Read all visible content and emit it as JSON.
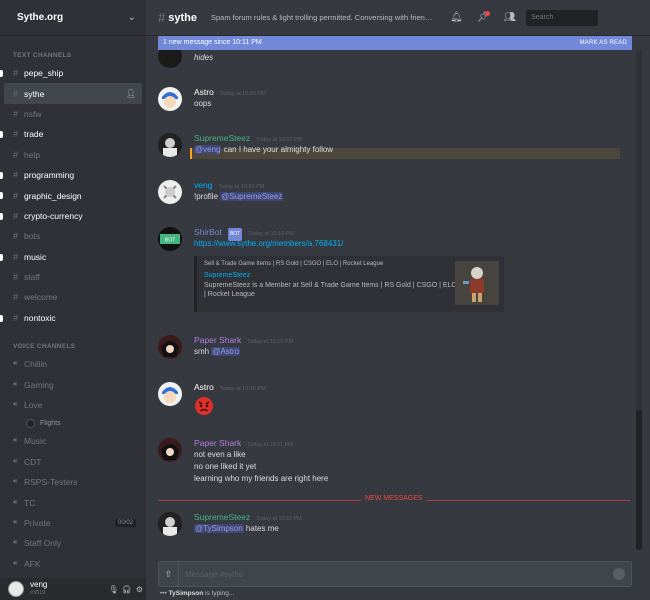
{
  "guild": {
    "name": "Sythe.org"
  },
  "sidebar": {
    "text_category": "TEXT CHANNELS",
    "text_channels": [
      {
        "name": "pepe_ship",
        "state": "unread"
      },
      {
        "name": "sythe",
        "state": "active"
      },
      {
        "name": "nsfw",
        "state": "muted"
      },
      {
        "name": "trade",
        "state": "unread"
      },
      {
        "name": "help",
        "state": "muted"
      },
      {
        "name": "programming",
        "state": "unread"
      },
      {
        "name": "graphic_design",
        "state": "unread"
      },
      {
        "name": "crypto-currency",
        "state": "unread"
      },
      {
        "name": "bots",
        "state": "muted"
      },
      {
        "name": "music",
        "state": "unread"
      },
      {
        "name": "staff",
        "state": "muted"
      },
      {
        "name": "welcome",
        "state": "muted"
      },
      {
        "name": "nontoxic",
        "state": "unread"
      }
    ],
    "voice_category": "VOICE CHANNELS",
    "voice_channels": [
      {
        "name": "Chillin",
        "badge": ""
      },
      {
        "name": "Gaming",
        "badge": ""
      },
      {
        "name": "Love",
        "badge": "",
        "users": [
          "Flights"
        ]
      },
      {
        "name": "Music",
        "badge": ""
      },
      {
        "name": "CDT",
        "badge": ""
      },
      {
        "name": "RSPS-Testers",
        "badge": ""
      },
      {
        "name": "TC",
        "badge": ""
      },
      {
        "name": "Private",
        "badge": "00/02"
      },
      {
        "name": "Staff Only",
        "badge": ""
      },
      {
        "name": "AFK",
        "badge": ""
      }
    ]
  },
  "user": {
    "name": "veng",
    "tag": "#3519"
  },
  "channel": {
    "name": "sythe",
    "topic": "Spam forum rules & light trolling permitted. Conversing with friends does n...",
    "search_placeholder": "Search"
  },
  "new_banner": {
    "text": "1 new message since 10:11 PM",
    "action": "MARK AS READ"
  },
  "messages": [
    {
      "id": "hides",
      "lines": [
        "hides"
      ]
    },
    {
      "id": "astro1",
      "author": "Astro",
      "color": "#ffffff",
      "time": "Today at 10:09 PM",
      "lines": [
        "oops"
      ]
    },
    {
      "id": "steez1",
      "author": "SupremeSteez",
      "color": "#43b581",
      "time": "Today at 10:10 PM",
      "mention": "@veng",
      "text": " can I have your almighty follow"
    },
    {
      "id": "veng1",
      "author": "veng",
      "color": "#00b0f4",
      "time": "Today at 10:10 PM",
      "prefix": "!profile ",
      "mention": "@SupremeSteez"
    },
    {
      "id": "bot1",
      "author": "ShirBot",
      "color": "#7289da",
      "bot": "BOT",
      "time": "Today at 10:10 PM",
      "link": "https://www.sythe.org/members/a.768431/",
      "embed": {
        "provider": "Sell & Trade Game Items | RS Gold | CSGO | ELO | Rocket League",
        "title": "SupremeSteez",
        "description": "SupremeSteez is a Member at Sell & Trade Game Items | RS Gold | CSGO | ELO | Rocket League"
      }
    },
    {
      "id": "shark1",
      "author": "Paper Shark",
      "color": "#b47ee0",
      "time": "Today at 10:10 PM",
      "prefix": "smh ",
      "mention": "@Astro"
    },
    {
      "id": "astro2",
      "author": "Astro",
      "color": "#ffffff",
      "time": "Today at 10:10 PM",
      "emoji": "angry-face"
    },
    {
      "id": "shark2",
      "author": "Paper Shark",
      "color": "#b47ee0",
      "time": "Today at 10:11 PM",
      "lines": [
        "not even a like",
        "no one liked it yet",
        "learning who my friends are right here"
      ]
    },
    {
      "id": "steez2",
      "author": "SupremeSteez",
      "color": "#43b581",
      "time": "Today at 10:11 PM",
      "mention": "@TySimpson",
      "text": " hates me"
    }
  ],
  "divider": {
    "label": "NEW MESSAGES"
  },
  "composer": {
    "placeholder": "Message #sythe"
  },
  "typing": {
    "user": "TySimpson",
    "text": " is typing..."
  },
  "colors": {
    "accent": "#7289da",
    "online": "#43b581",
    "danger": "#f04747",
    "mention_highlight": "#faa61a"
  }
}
